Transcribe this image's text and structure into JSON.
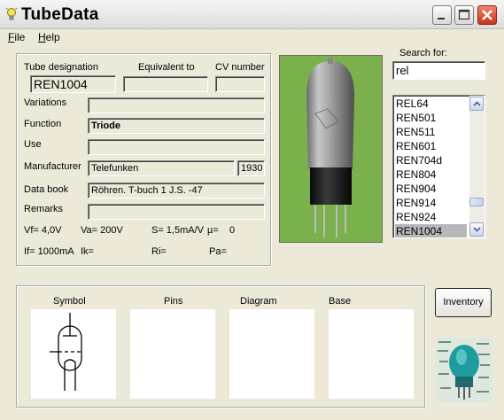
{
  "window": {
    "title": "TubeData"
  },
  "menu": [
    {
      "label": "File",
      "accel": "F",
      "rest": "ile"
    },
    {
      "label": "Help",
      "accel": "H",
      "rest": "elp"
    }
  ],
  "form": {
    "headers": {
      "designation": "Tube designation",
      "equivalent": "Equivalent to",
      "cv": "CV number"
    },
    "designation": "REN1004",
    "equivalent": "",
    "cv": "",
    "rows": {
      "variations": {
        "label": "Variations",
        "value": ""
      },
      "function": {
        "label": "Function",
        "value": "Triode"
      },
      "use": {
        "label": "Use",
        "value": ""
      },
      "manufacturer": {
        "label": "Manufacturer",
        "value": "Telefunken",
        "year": "1930"
      },
      "databook": {
        "label": "Data book",
        "value": "Röhren. T-buch 1 J.S. -47"
      },
      "remarks": {
        "label": "Remarks",
        "value": ""
      }
    },
    "specs": {
      "vf": "Vf= 4,0V",
      "va": "Va= 200V",
      "s": "S= 1,5mA/V",
      "mu": "µ=",
      "mu_val": "0",
      "if": "If= 1000mA",
      "ik": "Ik=",
      "ri": "Ri=",
      "pa": "Pa="
    }
  },
  "search": {
    "label": "Search for:",
    "value": "rel",
    "results": [
      "REL64",
      "REN501",
      "REN511",
      "REN601",
      "REN704d",
      "REN804",
      "REN904",
      "REN914",
      "REN924",
      "REN1004"
    ],
    "selected": "REN1004"
  },
  "bottom": {
    "symbol": "Symbol",
    "pins": "Pins",
    "diagram": "Diagram",
    "base": "Base"
  },
  "inventory_label": "Inventory"
}
